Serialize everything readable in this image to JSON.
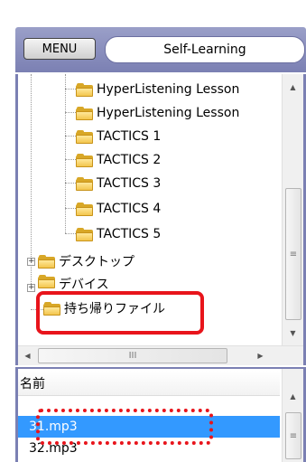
{
  "header": {
    "menu_label": "MENU",
    "title": "Self-Learning"
  },
  "tree": {
    "items": [
      {
        "label": "HyperListening Lesson",
        "icon": "folder-icon"
      },
      {
        "label": "HyperListening Lesson",
        "icon": "folder-icon"
      },
      {
        "label": "TACTICS 1",
        "icon": "folder-icon"
      },
      {
        "label": "TACTICS 2",
        "icon": "folder-icon"
      },
      {
        "label": "TACTICS 3",
        "icon": "folder-icon"
      },
      {
        "label": "TACTICS 4",
        "icon": "folder-icon"
      },
      {
        "label": "TACTICS 5",
        "icon": "folder-icon"
      },
      {
        "label": "デスクトップ",
        "icon": "folder-icon"
      },
      {
        "label": "デバイス",
        "icon": "device-folder-icon"
      },
      {
        "label": "持ち帰りファイル",
        "icon": "takeout-folder-icon"
      }
    ],
    "hscroll_thumb": "III"
  },
  "list": {
    "column_header": "名前",
    "rows": [
      {
        "label": "31.mp3",
        "selected": true
      },
      {
        "label": "32.mp3",
        "selected": false
      }
    ]
  },
  "colors": {
    "header_bg": "#7b80b3",
    "selection": "#3399ff",
    "highlight": "#e8141b",
    "folder": "#f3c64d"
  }
}
